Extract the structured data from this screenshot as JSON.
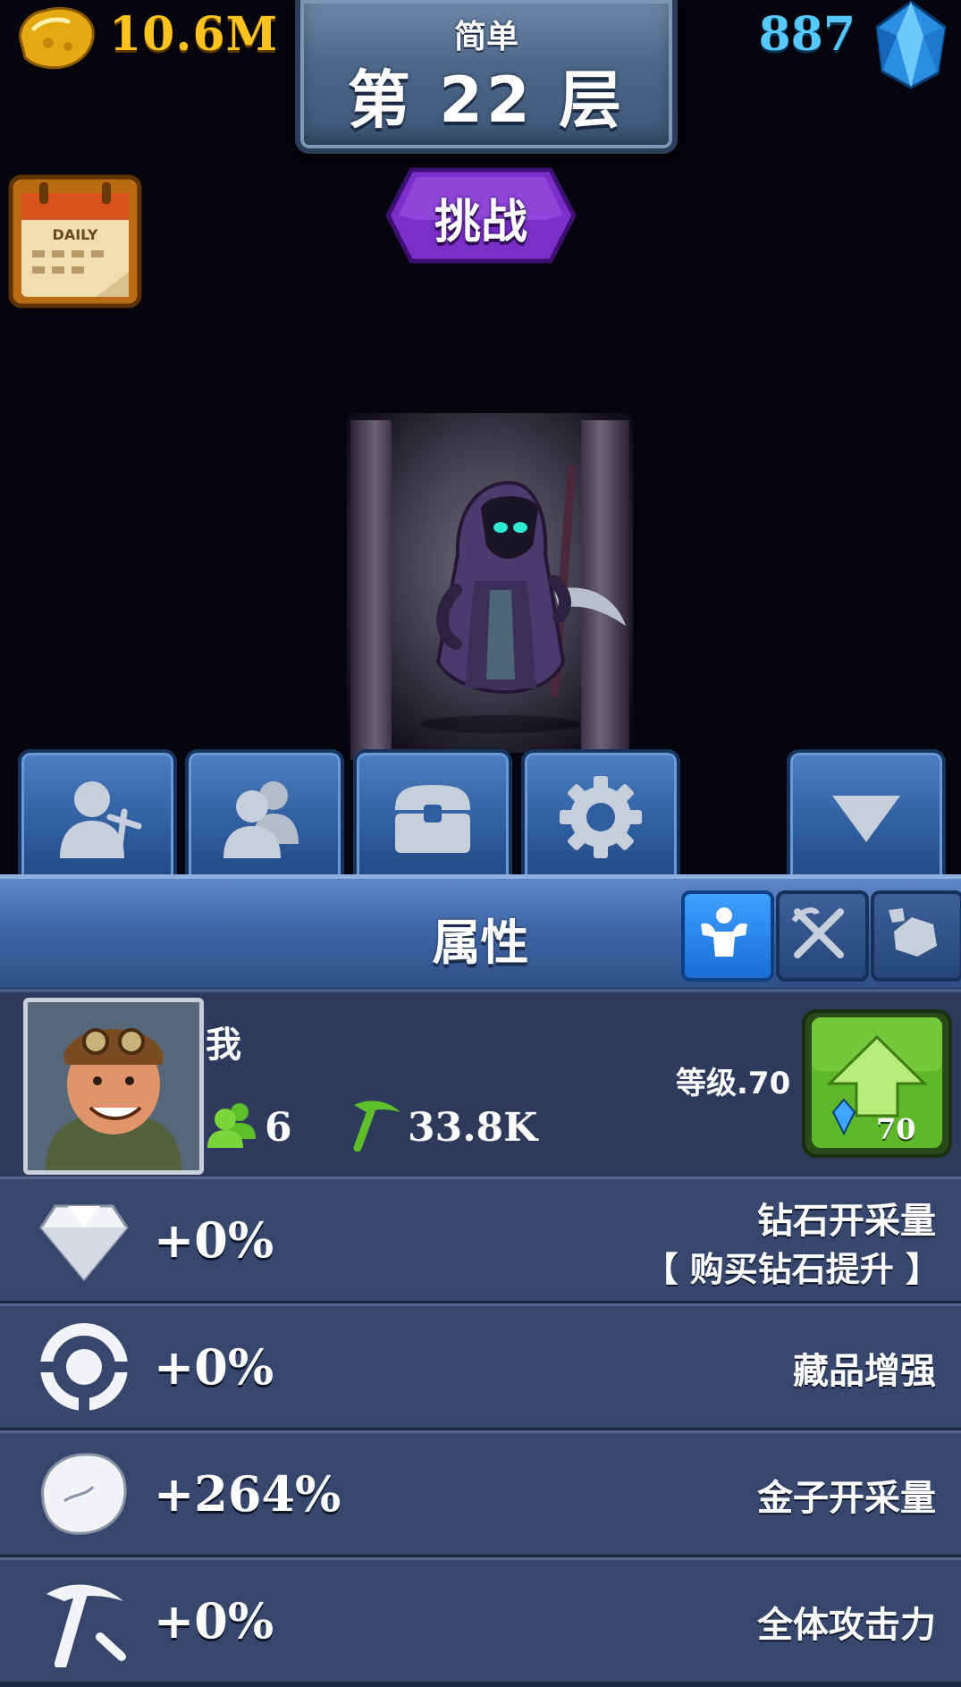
{
  "hud": {
    "gold_amount": "10.6M",
    "gold_icon": "gold-nugget-icon",
    "gem_amount": "887",
    "gem_icon": "blue-gem-icon"
  },
  "floor": {
    "difficulty": "简单",
    "label": "第 22 层"
  },
  "daily": {
    "icon": "daily-calendar-icon",
    "text": "DAILY"
  },
  "challenge": {
    "label": "挑战"
  },
  "tabs": [
    {
      "icon": "miner-profile-icon"
    },
    {
      "icon": "team-miners-icon"
    },
    {
      "icon": "treasure-chest-icon"
    },
    {
      "icon": "settings-gear-icon"
    },
    {
      "icon": "collapse-arrow-icon"
    }
  ],
  "panel": {
    "title": "属性",
    "sub_tabs": [
      {
        "icon": "strength-icon",
        "active": true
      },
      {
        "icon": "crossed-picks-icon",
        "active": false
      },
      {
        "icon": "ore-rock-icon",
        "active": false
      }
    ]
  },
  "player": {
    "name": "我",
    "miner_count": "6",
    "power": "33.8K",
    "level_text": "等级.70",
    "upgrade_cost": "70"
  },
  "stats": [
    {
      "icon": "diamond-icon",
      "value": "+0%",
      "name": "钻石开采量",
      "hint": "【 购买钻石提升 】"
    },
    {
      "icon": "collectible-ring-icon",
      "value": "+0%",
      "name": "藏品增强"
    },
    {
      "icon": "gold-ore-icon",
      "value": "+264%",
      "name": "金子开采量"
    },
    {
      "icon": "pickaxe-icon",
      "value": "+0%",
      "name": "全体攻击力"
    }
  ],
  "colors": {
    "gold": "#ffc21e",
    "gem": "#55c8ff",
    "panel_blue": "#3f67a6",
    "row_bg": "#36466c",
    "upgrade_green": "#5fb82a",
    "challenge_purple": "#7a2fc8"
  }
}
